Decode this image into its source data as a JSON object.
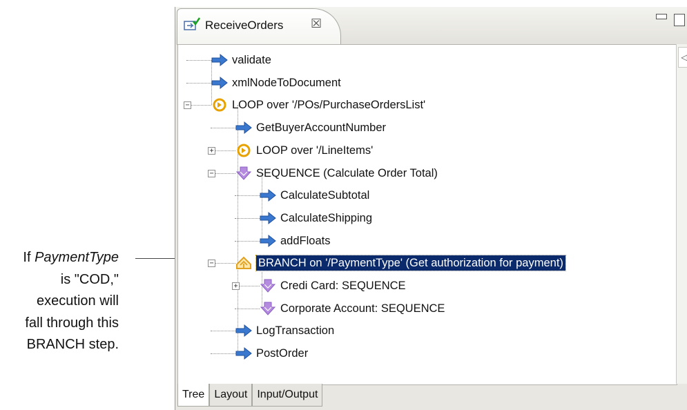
{
  "annotation": {
    "lines": [
      {
        "prefix": "If ",
        "emph": "PaymentType"
      },
      {
        "text": "is \"COD,\""
      },
      {
        "text": "execution will"
      },
      {
        "text": "fall through this"
      },
      {
        "text": "BRANCH step."
      }
    ]
  },
  "editor": {
    "tab_title": "ReceiveOrders",
    "tab_close": "☒",
    "bottom_tabs": [
      "Tree",
      "Layout",
      "Input/Output"
    ],
    "scroll_arrow": "◁"
  },
  "tree": [
    {
      "label": "validate",
      "icon": "invoke-arrow-icon"
    },
    {
      "label": "xmlNodeToDocument",
      "icon": "invoke-arrow-icon"
    },
    {
      "label": "LOOP over '/POs/PurchaseOrdersList'",
      "icon": "loop-icon",
      "expander": "⊟"
    },
    {
      "label": "GetBuyerAccountNumber",
      "icon": "invoke-arrow-icon"
    },
    {
      "label": "LOOP over '/LineItems'",
      "icon": "loop-icon",
      "expander": "⊞"
    },
    {
      "label": "SEQUENCE (Calculate Order Total)",
      "icon": "sequence-icon",
      "expander": "⊟"
    },
    {
      "label": "CalculateSubtotal",
      "icon": "invoke-arrow-icon"
    },
    {
      "label": "CalculateShipping",
      "icon": "invoke-arrow-icon"
    },
    {
      "label": "addFloats",
      "icon": "invoke-arrow-icon"
    },
    {
      "label": "BRANCH on '/PaymentType' (Get authorization for payment)",
      "icon": "branch-icon",
      "expander": "⊟",
      "selected": true
    },
    {
      "label": "Credi Card: SEQUENCE",
      "icon": "sequence-icon",
      "expander": "⊞"
    },
    {
      "label": "Corporate Account: SEQUENCE",
      "icon": "sequence-icon"
    },
    {
      "label": "LogTransaction",
      "icon": "invoke-arrow-icon"
    },
    {
      "label": "PostOrder",
      "icon": "invoke-arrow-icon"
    }
  ],
  "colors": {
    "selection_bg": "#0a2a6b",
    "invoke_arrow": "#3a78d0",
    "loop": "#e8a200",
    "sequence": "#b58be0",
    "branch": "#e0a020"
  }
}
